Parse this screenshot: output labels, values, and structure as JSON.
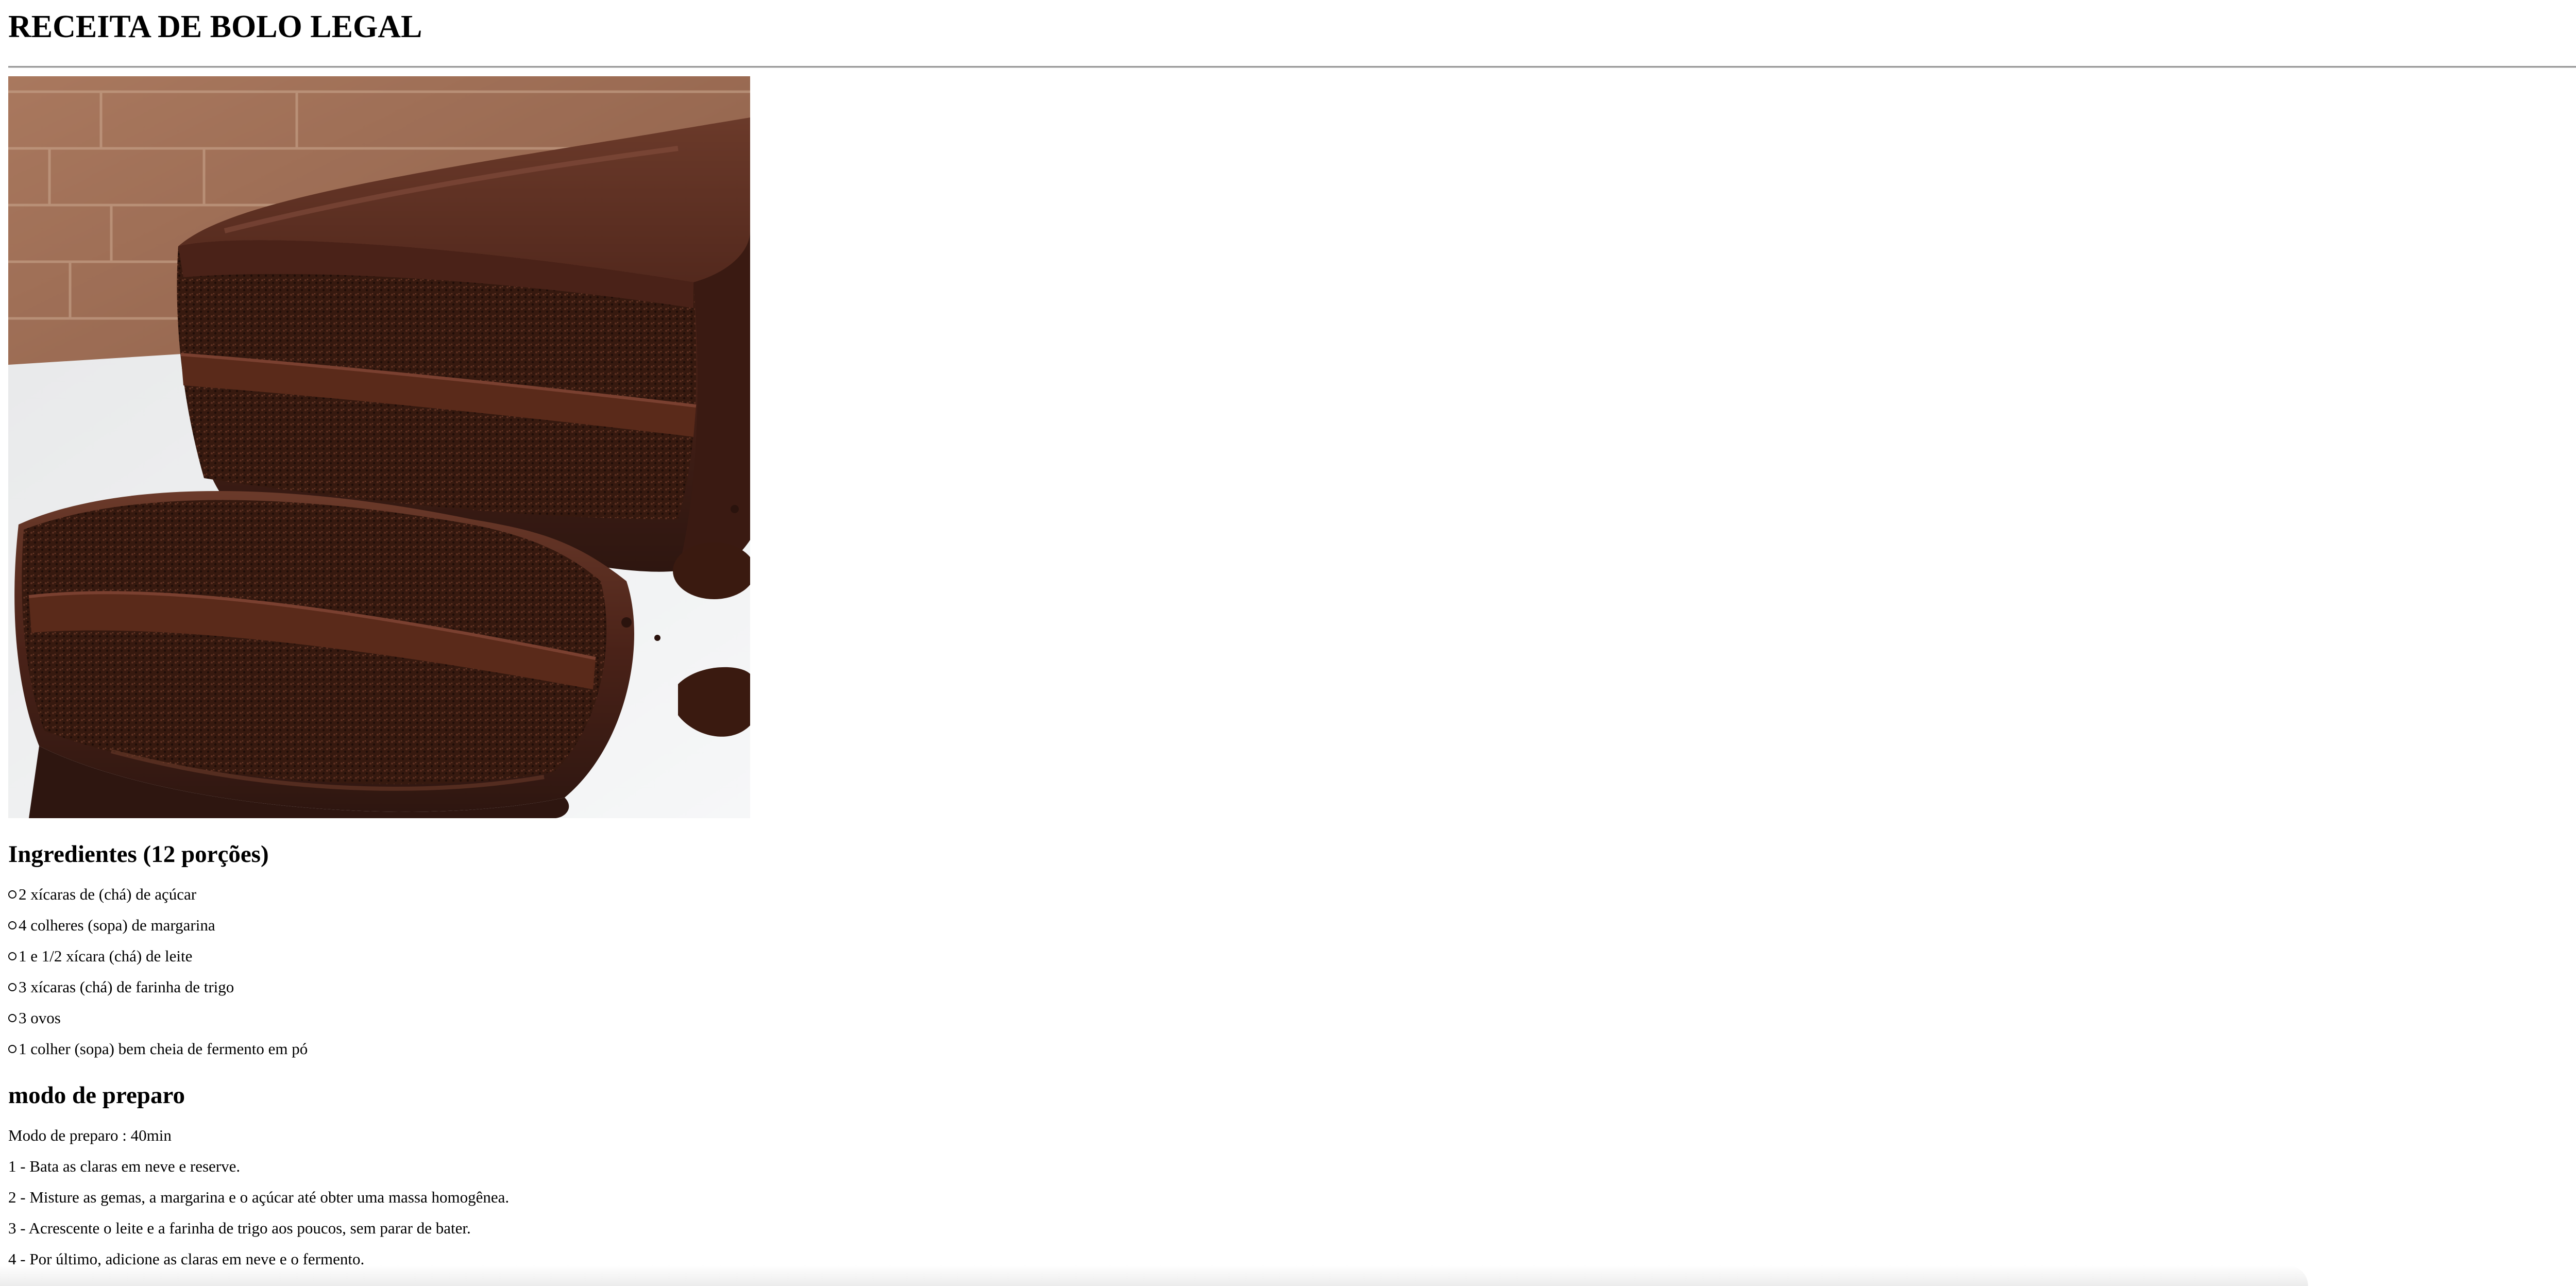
{
  "page": {
    "title": "RECEITA DE BOLO LEGAL"
  },
  "image": {
    "icon": "chocolate-cake-photo"
  },
  "ingredients": {
    "title": "Ingredientes (12 porções)",
    "items": [
      "2 xícaras de (chá) de açúcar",
      "4 colheres (sopa) de margarina",
      "1 e 1/2 xícara (chá) de leite",
      "3 xícaras (chá) de farinha de trigo",
      "3 ovos",
      "1 colher (sopa) bem cheia de fermento em pó"
    ]
  },
  "preparation": {
    "title": "modo de preparo",
    "time": "Modo de preparo : 40min",
    "steps": [
      "1 - Bata as claras em neve e reserve.",
      "2 - Misture as gemas, a margarina e o açúcar até obter uma massa homogênea.",
      "3 - Acrescente o leite e a farinha de trigo aos poucos, sem parar de bater.",
      "4 - Por último, adicione as claras em neve e o fermento."
    ]
  },
  "colors": {
    "text": "#000000",
    "background": "#ffffff",
    "rule": "#9a9a9a",
    "chocolate_dark": "#2e1610",
    "chocolate_mid": "#4a2218",
    "brick": "#9a6a52"
  }
}
